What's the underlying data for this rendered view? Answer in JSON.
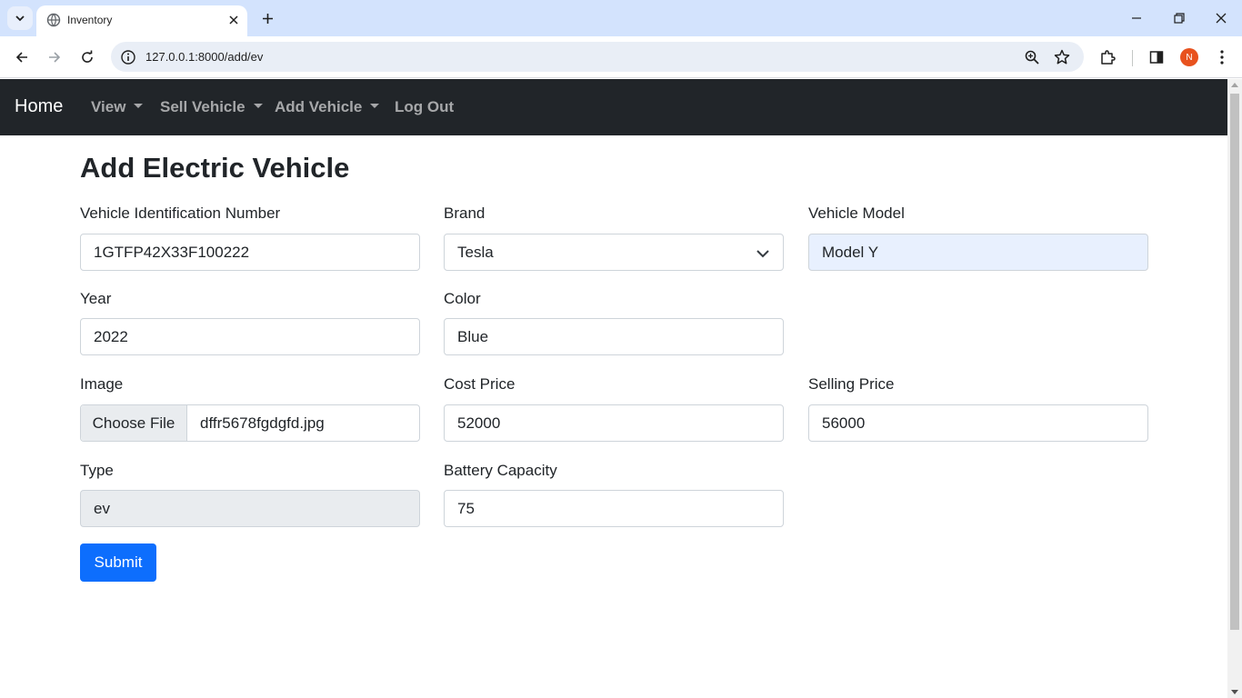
{
  "browser": {
    "tab_title": "Inventory",
    "url": "127.0.0.1:8000/add/ev",
    "profile_initial": "N"
  },
  "navbar": {
    "brand": "Home",
    "links": [
      "View",
      "Sell Vehicle",
      "Add Vehicle",
      "Log Out"
    ]
  },
  "form": {
    "title": "Add Electric Vehicle",
    "vin_label": "Vehicle Identification Number",
    "vin_value": "1GTFP42X33F100222",
    "brand_label": "Brand",
    "brand_value": "Tesla",
    "model_label": "Vehicle Model",
    "model_value": "Model Y",
    "year_label": "Year",
    "year_value": "2022",
    "color_label": "Color",
    "color_value": "Blue",
    "image_label": "Image",
    "image_button": "Choose File",
    "image_file": "dffr5678fgdgfd.jpg",
    "cost_label": "Cost Price",
    "cost_value": "52000",
    "selling_label": "Selling Price",
    "selling_value": "56000",
    "type_label": "Type",
    "type_value": "ev",
    "battery_label": "Battery Capacity",
    "battery_value": "75",
    "submit_label": "Submit"
  },
  "colors": {
    "navbar": "#212529",
    "primary": "#0d6efd",
    "autofill": "#e8f0fe",
    "readonly": "#e9ecef"
  },
  "icons": [
    "tab-list-icon",
    "globe-icon",
    "close-icon",
    "plus-icon",
    "minimize-icon",
    "restore-icon",
    "back-icon",
    "forward-icon",
    "reload-icon",
    "site-info-icon",
    "zoom-icon",
    "star-icon",
    "extensions-icon",
    "side-panel-icon",
    "more-vert-icon",
    "chevron-down-icon"
  ]
}
